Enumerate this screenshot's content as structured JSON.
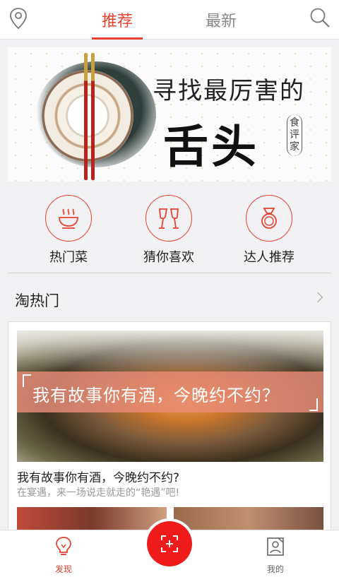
{
  "header": {
    "tabs": [
      {
        "label": "推荐",
        "active": true
      },
      {
        "label": "最新",
        "active": false
      }
    ]
  },
  "banner": {
    "title_line1": "寻找最厉害的",
    "title_line2": "舌头",
    "subtitle": "食评家"
  },
  "categories": [
    {
      "label": "热门菜",
      "icon": "hot-dish-icon"
    },
    {
      "label": "猜你喜欢",
      "icon": "cheers-glasses-icon"
    },
    {
      "label": "达人推荐",
      "icon": "ring-icon"
    }
  ],
  "section": {
    "title": "淘热门"
  },
  "card": {
    "overlay_text": "我有故事你有酒，今晚约不约？",
    "title": "我有故事你有酒，今晚约不约?",
    "description": "在宴遇，来一场说走就走的“艳遇”吧!"
  },
  "bottom_nav": {
    "items": [
      {
        "label": "发现",
        "icon": "lightbulb-icon",
        "active": true
      },
      {
        "label": "我的",
        "icon": "profile-card-icon",
        "active": false
      }
    ],
    "center_icon": "scan-icon"
  },
  "colors": {
    "accent": "#e8412f",
    "scan_button": "#f01c1c",
    "background": "#f2f2f5"
  }
}
